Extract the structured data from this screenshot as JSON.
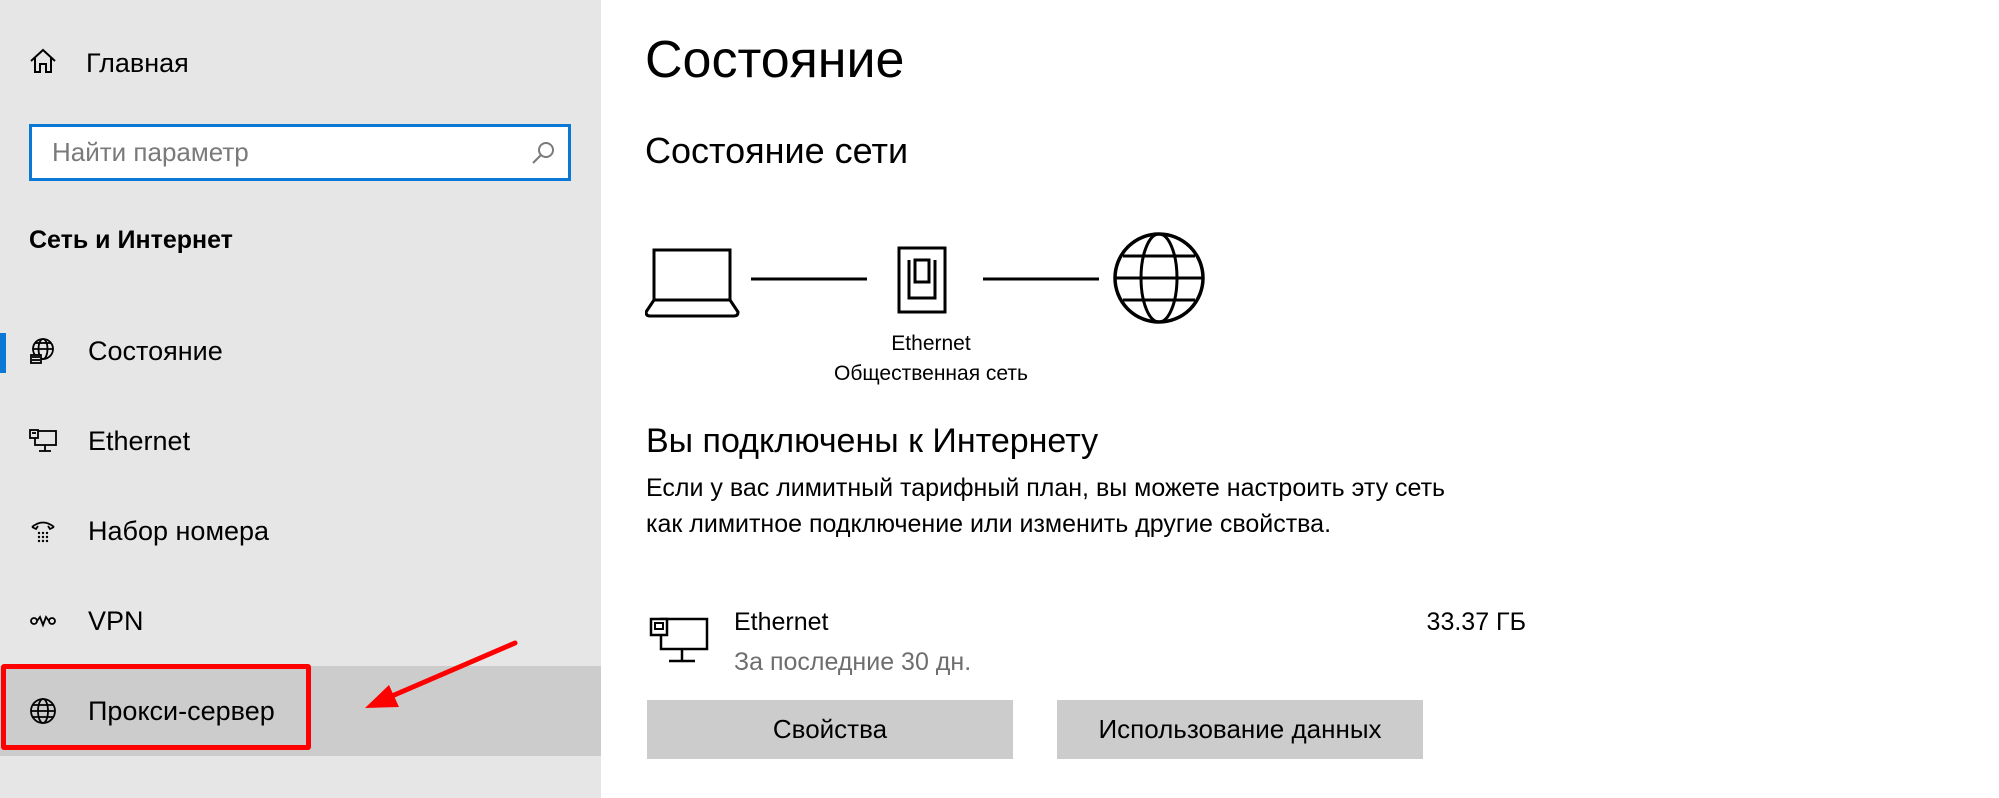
{
  "sidebar": {
    "home_label": "Главная",
    "search_placeholder": "Найти параметр",
    "section_title": "Сеть и Интернет",
    "items": [
      {
        "label": "Состояние",
        "icon": "globe-status-icon",
        "active": true
      },
      {
        "label": "Ethernet",
        "icon": "ethernet-icon"
      },
      {
        "label": "Набор номера",
        "icon": "dialup-icon"
      },
      {
        "label": "VPN",
        "icon": "vpn-icon"
      },
      {
        "label": "Прокси-сервер",
        "icon": "globe-icon",
        "hovered": true
      }
    ]
  },
  "main": {
    "title": "Состояние",
    "subtitle": "Состояние сети",
    "diagram": {
      "adapter_name": "Ethernet",
      "network_type": "Общественная сеть"
    },
    "connected_title": "Вы подключены к Интернету",
    "connected_desc": "Если у вас лимитный тарифный план, вы можете настроить эту сеть как лимитное подключение или изменить другие свойства.",
    "adapter": {
      "name": "Ethernet",
      "period": "За последние 30 дн.",
      "usage": "33.37 ГБ"
    },
    "buttons": {
      "properties": "Свойства",
      "data_usage": "Использование данных"
    }
  },
  "colors": {
    "sidebar_bg": "#e6e6e6",
    "accent": "#0a78d4",
    "hover_bg": "#cccccc",
    "annotation": "#ff0000"
  }
}
